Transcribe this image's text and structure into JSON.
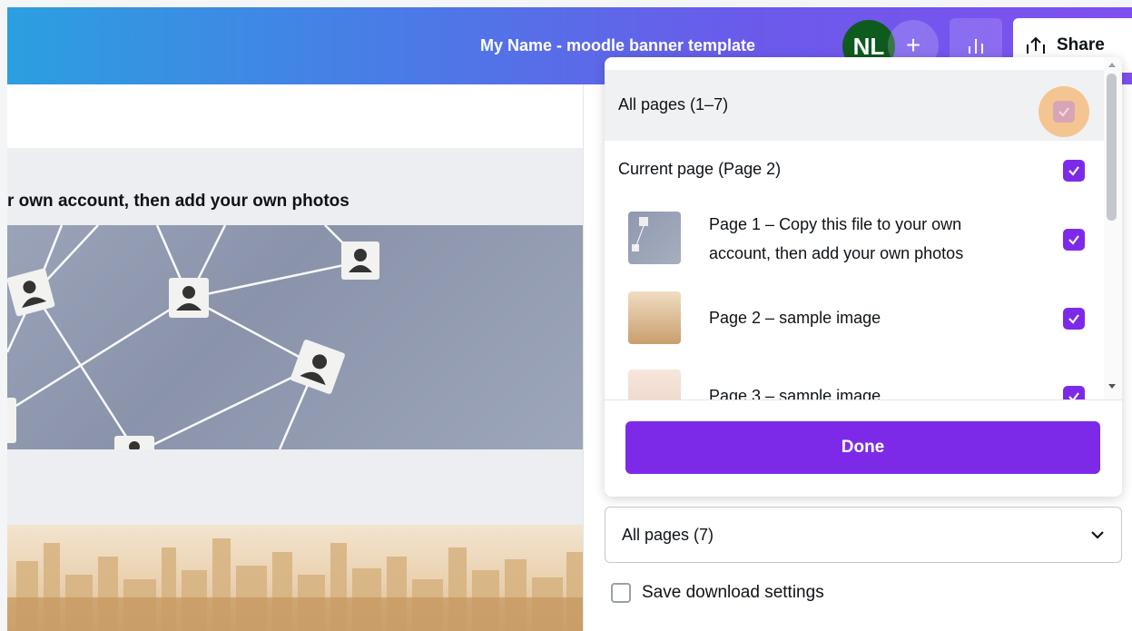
{
  "header": {
    "doc_title": "My Name - moodle banner template",
    "avatar_initials": "NL",
    "plus_glyph": "+",
    "share_label": "Share",
    "gradient": [
      "#2c9fe0",
      "#7f4ff0"
    ]
  },
  "canvas": {
    "page1_caption": "r own account, then add your own photos"
  },
  "dropdown": {
    "accent": "#7d2ae8",
    "rows": [
      {
        "label": "All pages (1–7)",
        "checked": true
      },
      {
        "label": "Current page (Page 2)",
        "checked": true
      },
      {
        "label_line1": "Page 1 – Copy this file to your own",
        "label_line2": "account, then add your own photos",
        "checked": true
      },
      {
        "label": "Page 2 – sample image",
        "checked": true
      },
      {
        "label": "Page 3 – sample image",
        "checked": true
      }
    ],
    "done_label": "Done"
  },
  "download": {
    "pages_select_value": "All pages (7)",
    "save_settings_label": "Save download settings",
    "save_settings_checked": false
  }
}
